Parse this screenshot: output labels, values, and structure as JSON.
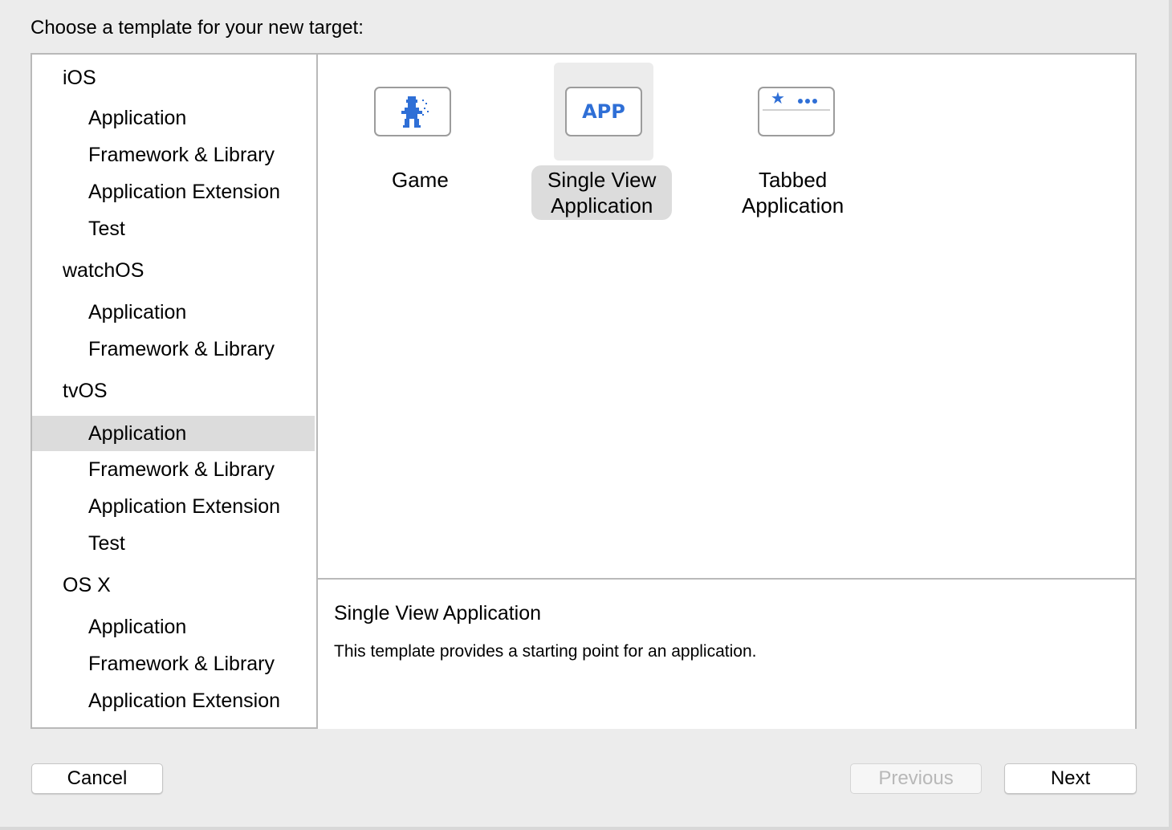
{
  "heading": "Choose a template for your new target:",
  "sidebar": {
    "groups": [
      {
        "platform": "iOS",
        "items": [
          "Application",
          "Framework & Library",
          "Application Extension",
          "Test"
        ]
      },
      {
        "platform": "watchOS",
        "items": [
          "Application",
          "Framework & Library"
        ]
      },
      {
        "platform": "tvOS",
        "items": [
          "Application",
          "Framework & Library",
          "Application Extension",
          "Test"
        ]
      },
      {
        "platform": "OS X",
        "items": [
          "Application",
          "Framework & Library",
          "Application Extension"
        ]
      }
    ],
    "selected": "tvOS / Application"
  },
  "templates": [
    {
      "label_line1": "Game",
      "label_line2": "",
      "icon": "game-sprite-icon"
    },
    {
      "label_line1": "Single View",
      "label_line2": "Application",
      "icon": "app-icon",
      "icon_text": "APP",
      "selected": true
    },
    {
      "label_line1": "Tabbed",
      "label_line2": "Application",
      "icon": "tab-bar-icon"
    }
  ],
  "detail": {
    "title": "Single View Application",
    "description": "This template provides a starting point for an application."
  },
  "buttons": {
    "cancel": "Cancel",
    "previous": "Previous",
    "next": "Next"
  },
  "colors": {
    "accent": "#2f6fd6",
    "selection": "#dcdcdc",
    "background": "#ececec"
  }
}
